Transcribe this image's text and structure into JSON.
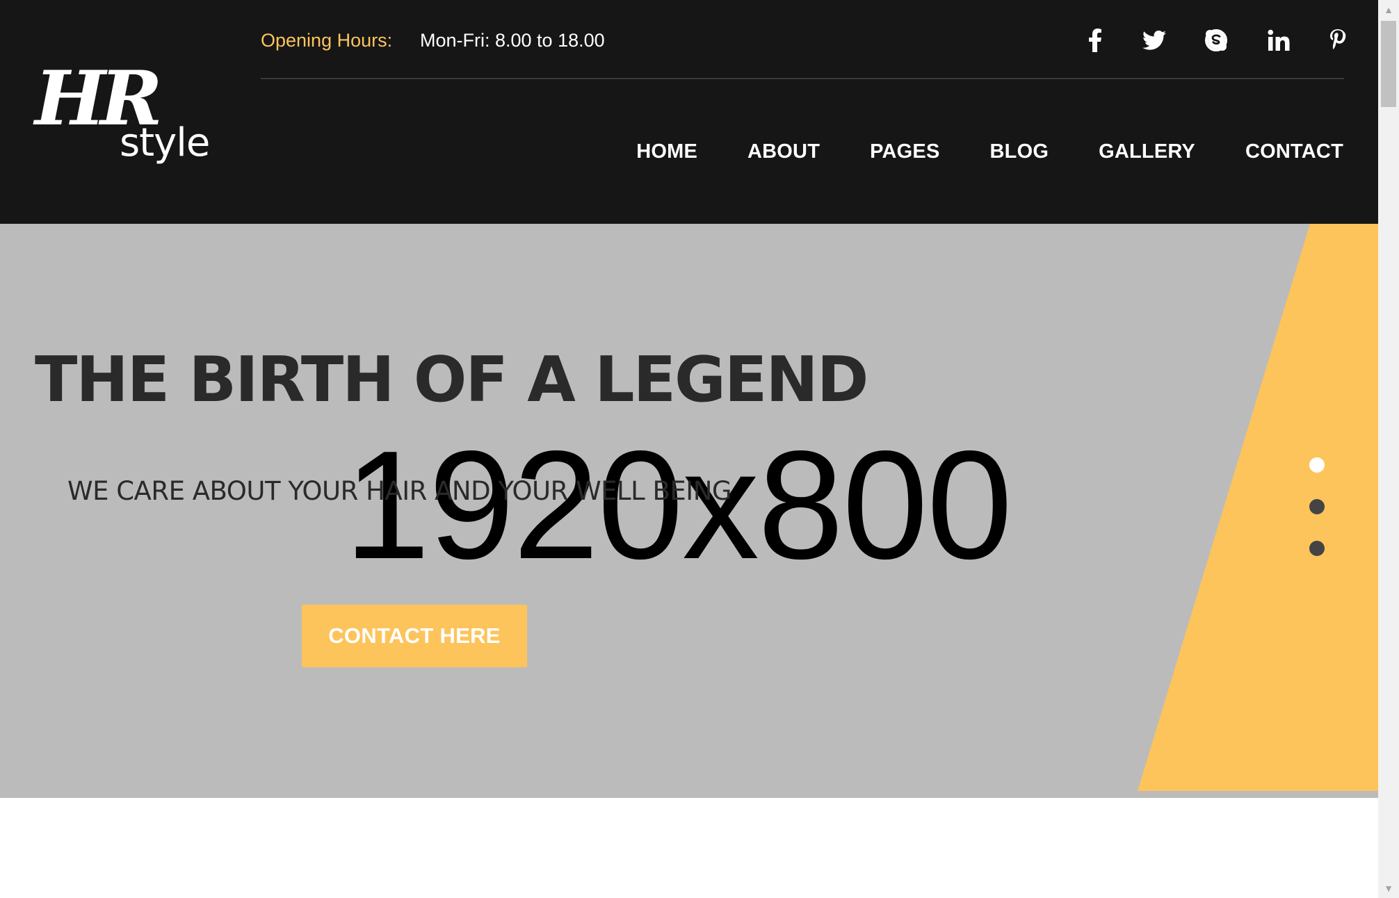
{
  "header": {
    "logo": {
      "mark": "HR",
      "word": "style"
    },
    "opening_hours_label": "Opening Hours:",
    "opening_hours_value": "Mon-Fri: 8.00 to 18.00",
    "social_icons": [
      "facebook-icon",
      "twitter-icon",
      "skype-icon",
      "linkedin-icon",
      "pinterest-icon"
    ],
    "nav": [
      "HOME",
      "ABOUT",
      "PAGES",
      "BLOG",
      "GALLERY",
      "CONTACT"
    ]
  },
  "hero": {
    "placeholder": "1920x800",
    "title": "THE BIRTH OF A LEGEND",
    "subtitle": "WE CARE ABOUT YOUR HAIR AND YOUR WELL BEING",
    "button_label": "CONTACT HERE",
    "slides": {
      "count": 3,
      "active": 1
    }
  },
  "colors": {
    "header_bg": "#161616",
    "accent": "#fdc45c",
    "hero_bg": "#bbbbbb",
    "text_dark": "#2a2a2a"
  }
}
